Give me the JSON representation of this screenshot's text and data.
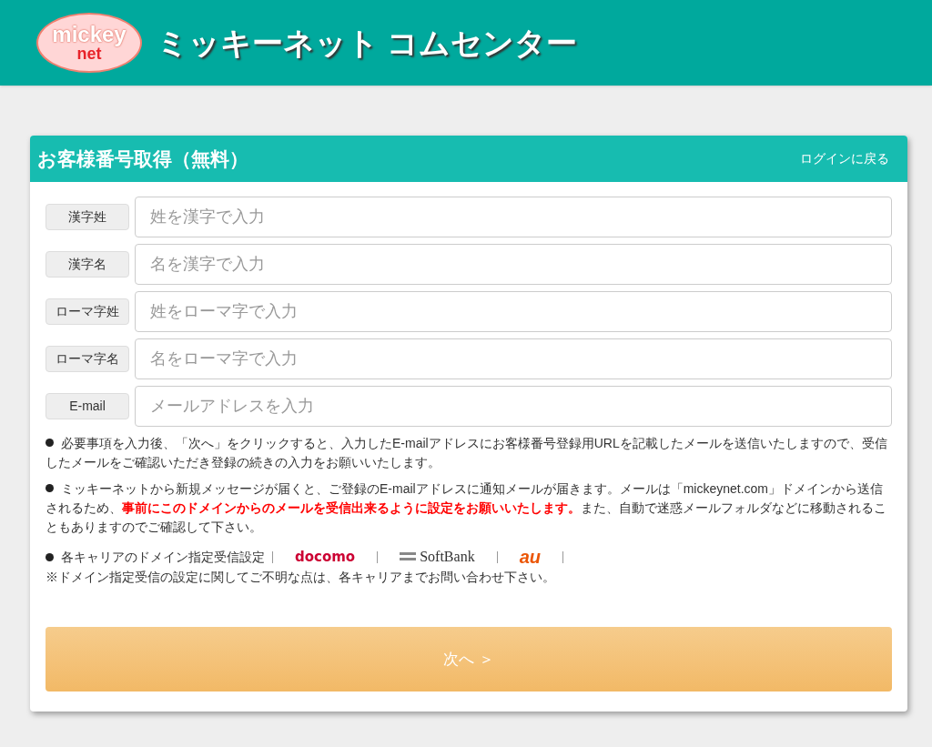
{
  "header": {
    "logo_top": "mickey",
    "logo_bottom": "net",
    "title": "ミッキーネット コムセンター"
  },
  "card": {
    "title": "お客様番号取得（無料）",
    "back_link": "ログインに戻る",
    "fields": [
      {
        "label": "漢字姓",
        "placeholder": "姓を漢字で入力"
      },
      {
        "label": "漢字名",
        "placeholder": "名を漢字で入力"
      },
      {
        "label": "ローマ字姓",
        "placeholder": "姓をローマ字で入力"
      },
      {
        "label": "ローマ字名",
        "placeholder": "名をローマ字で入力"
      },
      {
        "label": "E-mail",
        "placeholder": "メールアドレスを入力"
      }
    ],
    "notes": [
      "必要事項を入力後、「次へ」をクリックすると、入力したE-mailアドレスにお客様番号登録用URLを記載したメールを送信いたしますので、受信したメールをご確認いただき登録の続きの入力をお願いいたします。",
      "ミッキーネットから新規メッセージが届くと、ご登録のE-mailアドレスに通知メールが届きます。メールは「mickeynet.com」ドメインから送信されるため、**事前にこのドメインからのメールを受信出来るように設定をお願いいたします。**また、自動で迷惑メールフォルダなどに移動されることもありますのでご確認して下さい。"
    ],
    "carrier_label": "各キャリアのドメイン指定受信設定",
    "carriers": [
      {
        "kind": "docomo",
        "name": "docomo"
      },
      {
        "kind": "softbank",
        "name": "SoftBank"
      },
      {
        "kind": "au",
        "name": "au"
      }
    ],
    "carrier_note": "※ドメイン指定受信の設定に関してご不明な点は、各キャリアまでお問い合わせ下さい。",
    "next_button": "次へ ＞"
  }
}
